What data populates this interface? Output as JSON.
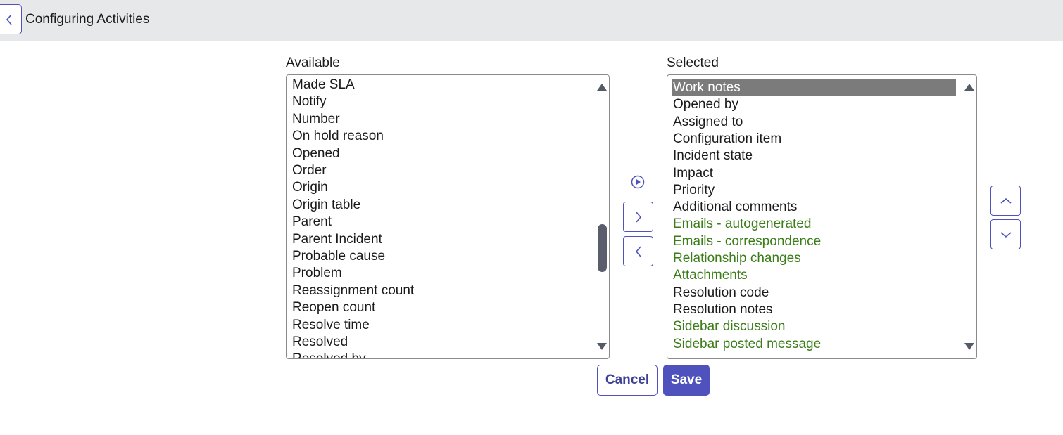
{
  "header": {
    "title": "Configuring Activities",
    "back_icon": "chevron-left-icon"
  },
  "available": {
    "label": "Available",
    "items": [
      {
        "label": "Made SLA"
      },
      {
        "label": "Notify"
      },
      {
        "label": "Number"
      },
      {
        "label": "On hold reason"
      },
      {
        "label": "Opened"
      },
      {
        "label": "Order"
      },
      {
        "label": "Origin"
      },
      {
        "label": "Origin table"
      },
      {
        "label": "Parent"
      },
      {
        "label": "Parent Incident"
      },
      {
        "label": "Probable cause"
      },
      {
        "label": "Problem"
      },
      {
        "label": "Reassignment count"
      },
      {
        "label": "Reopen count"
      },
      {
        "label": "Resolve time"
      },
      {
        "label": "Resolved"
      },
      {
        "label": "Resolved by"
      }
    ],
    "scroll_position": 0.62
  },
  "selected": {
    "label": "Selected",
    "items": [
      {
        "label": "Work notes",
        "selected": true
      },
      {
        "label": "Opened by"
      },
      {
        "label": "Assigned to"
      },
      {
        "label": "Configuration item"
      },
      {
        "label": "Incident state"
      },
      {
        "label": "Impact"
      },
      {
        "label": "Priority"
      },
      {
        "label": "Additional comments"
      },
      {
        "label": "Emails - autogenerated",
        "green": true
      },
      {
        "label": "Emails - correspondence",
        "green": true
      },
      {
        "label": "Relationship changes",
        "green": true
      },
      {
        "label": "Attachments",
        "green": true
      },
      {
        "label": "Resolution code"
      },
      {
        "label": "Resolution notes"
      },
      {
        "label": "Sidebar discussion",
        "green": true
      },
      {
        "label": "Sidebar posted message",
        "green": true
      }
    ]
  },
  "controls": {
    "add_icon": "chevron-right-icon",
    "remove_icon": "chevron-left-icon",
    "move_up_icon": "chevron-up-icon",
    "move_down_icon": "chevron-down-icon",
    "play_icon": "play-circle-icon"
  },
  "actions": {
    "cancel_label": "Cancel",
    "save_label": "Save"
  },
  "colors": {
    "accent": "#4f52bd",
    "special_field_text": "#3b7d18",
    "selected_row_bg": "#7b7b7b",
    "header_bg": "#e7e8ea"
  }
}
